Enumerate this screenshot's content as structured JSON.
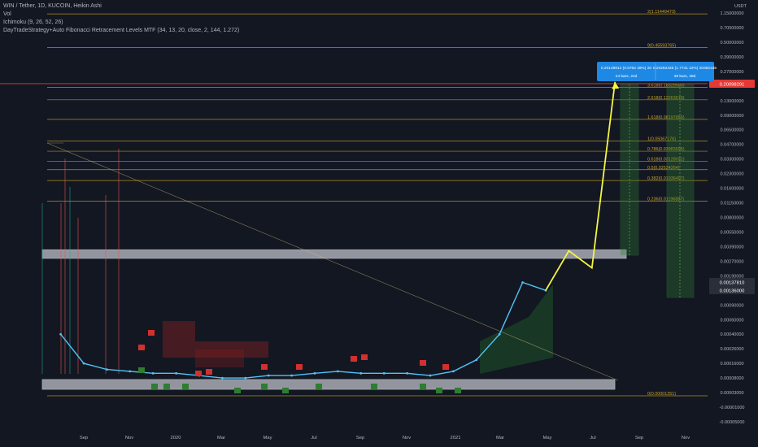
{
  "header": {
    "symbol_line": "WIN / Tether, 1D, KUCOIN, Heikin Ashi",
    "vol_label": "Vol",
    "ichimoku_label": "Ichimoku (9, 26, 52, 26)",
    "strategy_label": "DayTradeStrategy+Auto Fibonacci Retracement Levels MTF (34, 13, 20, close, 2, 144, 1.272)"
  },
  "colors": {
    "background": "#131722",
    "fib_line": "#c9a227",
    "trend_arrow": "#f5f542",
    "zone_gray": "#b2b5be",
    "target_green": "#2e7d32",
    "label_blue": "#1e88e5",
    "red_hline": "#e53935",
    "cloud_red": "#7a1f1f",
    "cloud_green": "#1f5f2a",
    "price_line": "#4fc3f7",
    "candle_red": "#ef5350",
    "candle_green": "#26a69a",
    "sell_marker": "#d32f2f",
    "buy_marker": "#2e7d32"
  },
  "chart_data": {
    "type": "line",
    "title": "WIN / Tether, 1D, KUCOIN, Heikin Ashi",
    "x_axis": {
      "labels": [
        "Sep",
        "Nov",
        "2020",
        "Mar",
        "May",
        "Jul",
        "Sep",
        "Nov",
        "2021",
        "Mar",
        "May",
        "Jul",
        "Sep",
        "Nov"
      ]
    },
    "y_axis": {
      "scale": "log",
      "currency": "USDT",
      "labels": [
        "1.15000000",
        "0.70000000",
        "0.50000000",
        "0.39000000",
        "0.27000000",
        "0.19000000",
        "0.13000000",
        "0.09000000",
        "0.06500000",
        "0.04700000",
        "0.03300000",
        "0.02300000",
        "0.01600000",
        "0.01150000",
        "0.00800000",
        "0.00550000",
        "0.00390000",
        "0.00270000",
        "0.00190000",
        "0.00130000",
        "0.00090000",
        "0.00060000",
        "0.00040000",
        "0.00026000",
        "0.00016000",
        "0.00008000",
        "0.00003000",
        "-0.00001000",
        "-0.00005000"
      ]
    },
    "fib_levels": [
      {
        "label": "2(1.11449473)"
      },
      {
        "label": "9(0.45593765)"
      },
      {
        "label": "3.618(0.18329503)"
      },
      {
        "label": "2.618(0.13263679)"
      },
      {
        "label": "1.618(0.08197855)"
      },
      {
        "label": "1(0.05067176)"
      },
      {
        "label": "0.786(0.03983095)"
      },
      {
        "label": "0.618(0.03128031)"
      },
      {
        "label": "0.5(0.02534264)"
      },
      {
        "label": "0.382(0.01936497)"
      },
      {
        "label": "0.236(0.01196887)"
      },
      {
        "label": "0(0.00001351)"
      }
    ],
    "price_tags": [
      {
        "text": "0.20098291",
        "color": "#e53935"
      },
      {
        "text": "0.00137810",
        "color": "#2a2e39"
      },
      {
        "text": "0.00136000",
        "color": "#2a2e39"
      }
    ],
    "measure_box": {
      "line1_left": "0.20139912 (0.6762 49%) 20",
      "line1_right": "0.20262435 (1.7741 22%) 20362435",
      "line2_left": "24 bars, 24d",
      "line2_right": "38 bars, 38d"
    },
    "series": [
      {
        "name": "",
        "x": [
          "Aug 2019",
          "Sep 2019",
          "Oct 2019",
          "Nov 2019",
          "Dec 2019",
          "Jan 2020",
          "Feb 2020",
          "Mar 2020",
          "Apr 2020",
          "May 2020",
          "Jun 2020",
          "Jul 2020",
          "Aug 2020",
          "Sep 2020",
          "Oct 2020",
          "Nov 2020",
          "Dec 2020",
          "Jan 2021",
          "Feb 2021",
          "Mar 2021",
          "Apr 2021",
          "May 2021"
        ],
        "values": [
          0.0004,
          0.00016,
          0.00012,
          0.00011,
          0.0001,
          0.0001,
          9e-05,
          8e-05,
          8e-05,
          9e-05,
          9e-05,
          0.0001,
          0.00011,
          0.0001,
          0.0001,
          0.0001,
          9e-05,
          0.00011,
          0.00018,
          0.0004,
          0.0016,
          0.0013
        ]
      }
    ],
    "projection": {
      "from": "May 2021",
      "values": [
        0.0013,
        0.0035,
        0.0023,
        0.21
      ],
      "to": "Aug 2021"
    },
    "zones": [
      {
        "name": "resistance",
        "from": 0.0029,
        "to": 0.0036
      },
      {
        "name": "support",
        "from": 3e-05,
        "to": 6e-05
      }
    ],
    "grid": false
  }
}
